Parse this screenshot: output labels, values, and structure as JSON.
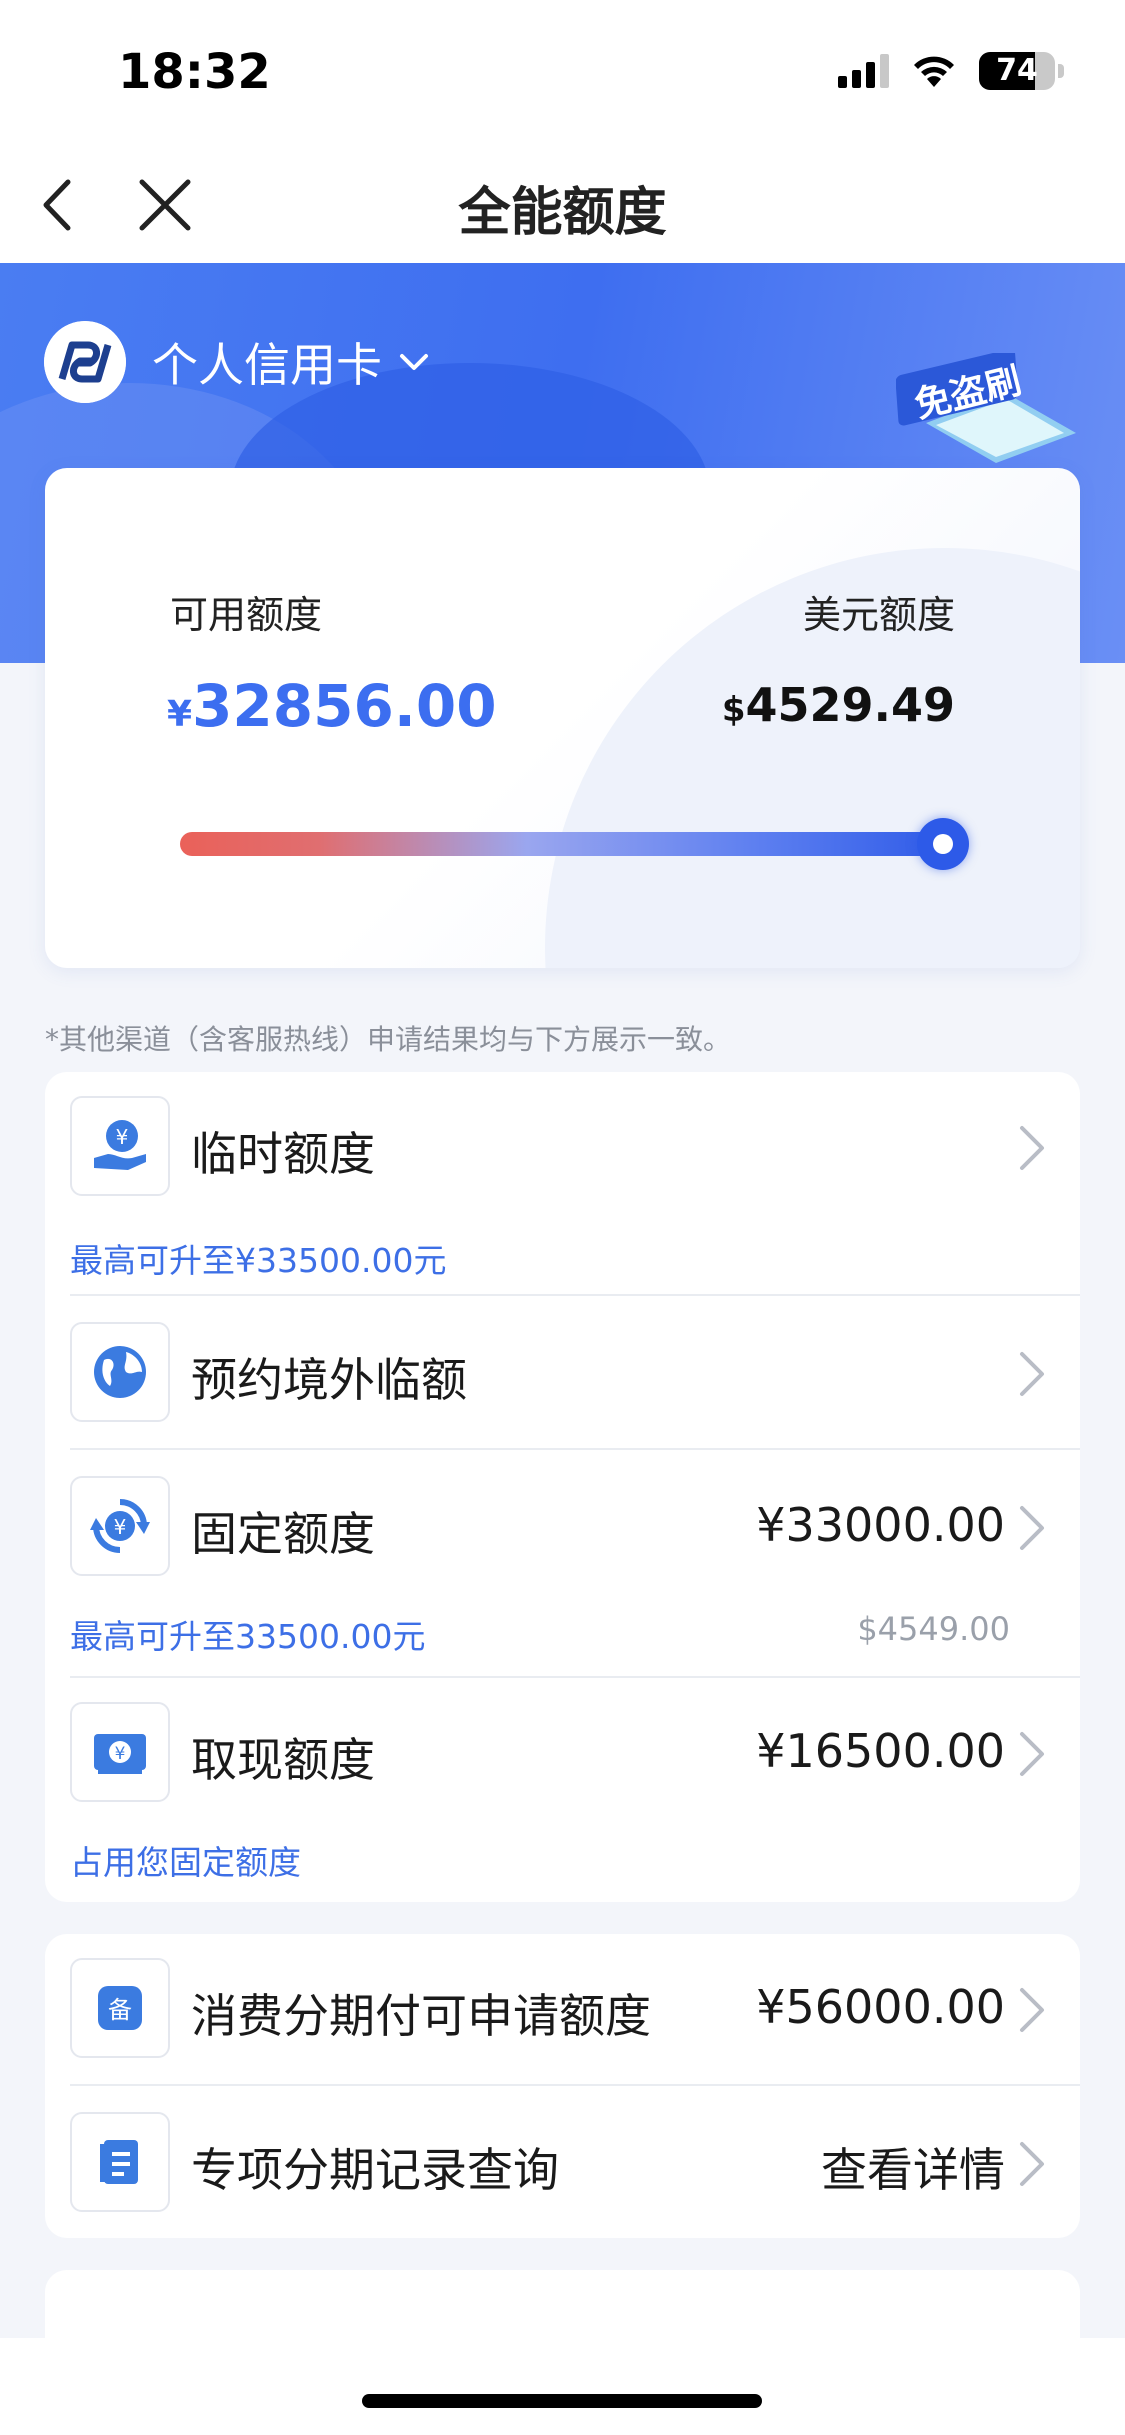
{
  "status": {
    "time": "18:32",
    "battery": "74"
  },
  "nav": {
    "title": "全能额度"
  },
  "hero": {
    "card_type": "个人信用卡",
    "badge_text": "免盗刷"
  },
  "limit": {
    "available_label": "可用额度",
    "available_currency": "¥",
    "available_value": "32856.00",
    "usd_label": "美元额度",
    "usd_currency": "$",
    "usd_value": "4529.49"
  },
  "note": "*其他渠道（含客服热线）申请结果均与下方展示一致。",
  "rows": {
    "temp": {
      "title": "临时额度",
      "sub": "最高可升至¥33500.00元"
    },
    "overseas": {
      "title": "预约境外临额"
    },
    "fixed": {
      "title": "固定额度",
      "value": "¥33000.00",
      "sub": "最高可升至33500.00元",
      "sub_right": "$4549.00"
    },
    "cash": {
      "title": "取现额度",
      "value": "¥16500.00",
      "sub": "占用您固定额度"
    },
    "installment": {
      "title": "消费分期付可申请额度",
      "value": "¥56000.00"
    },
    "special": {
      "title": "专项分期记录查询",
      "value": "查看详情"
    }
  },
  "icons": {
    "back": "chevron-left-icon",
    "close": "close-icon",
    "chevron": "chevron-right-icon",
    "temp": "hand-yuan-icon",
    "overseas": "globe-icon",
    "fixed": "yuan-cycle-icon",
    "cash": "banknote-icon",
    "installment": "file-box-icon",
    "special": "document-icon"
  },
  "colors": {
    "accent": "#3c6ef0",
    "hero": "#4a7df2",
    "bar_start": "#ea6159",
    "bar_end": "#2f5be8"
  }
}
